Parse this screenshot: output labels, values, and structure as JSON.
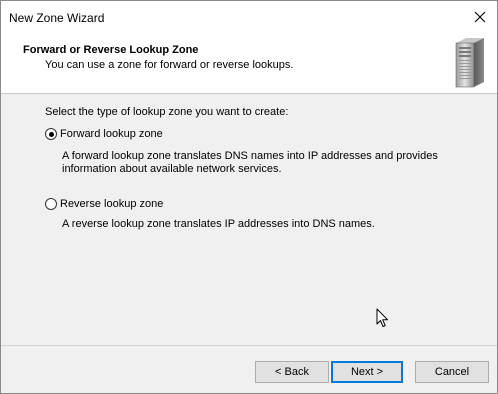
{
  "window": {
    "title": "New Zone Wizard"
  },
  "header": {
    "title": "Forward or Reverse Lookup Zone",
    "subtitle": "You can use a zone for forward or reverse lookups."
  },
  "body": {
    "prompt": "Select the type of lookup zone you want to create:",
    "options": [
      {
        "label": "Forward lookup zone",
        "selected": true,
        "description": "A forward lookup zone translates DNS names into IP addresses and provides information about available network services."
      },
      {
        "label": "Reverse lookup zone",
        "selected": false,
        "description": "A reverse lookup zone translates IP addresses into DNS names."
      }
    ]
  },
  "buttons": {
    "back": "< Back",
    "next": "Next >",
    "cancel": "Cancel"
  },
  "icons": {
    "close": "close-icon",
    "header": "server-icon",
    "pointer": "mouse-cursor"
  }
}
